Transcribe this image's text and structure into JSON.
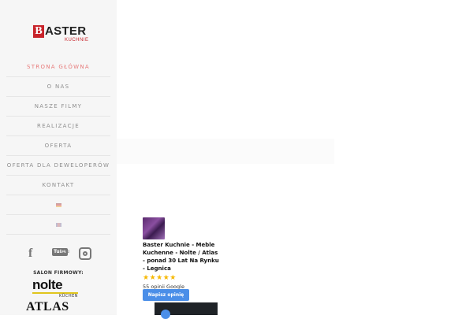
{
  "logo": {
    "letter": "B",
    "text": "ASTER",
    "sub": "KUCHNIE"
  },
  "nav": {
    "items": [
      {
        "label": "Strona główna",
        "active": true
      },
      {
        "label": "O nas",
        "active": false
      },
      {
        "label": "Nasze filmy",
        "active": false
      },
      {
        "label": "Realizacje",
        "active": false
      },
      {
        "label": "Oferta",
        "active": false
      },
      {
        "label": "Oferta dla deweloperów",
        "active": false
      },
      {
        "label": "Kontakt",
        "active": false
      }
    ],
    "flags": [
      "german-flag-icon",
      "uk-flag-icon"
    ]
  },
  "social": {
    "icons": [
      "facebook-icon",
      "youtube-icon",
      "instagram-icon"
    ],
    "youtube_text": "You",
    "youtube_tube": "Tube"
  },
  "salon": {
    "label": "SALON FIRMOWY:",
    "nolte": "nolte",
    "nolte_sub": "KÜCHEN",
    "atlas": "ATLAS"
  },
  "review": {
    "title": "Baster Kuchnie - Meble Kuchenne - Nolte / Atlas - ponad 30 Lat Na Rynku - Legnica",
    "stars": "★★★★★",
    "rating": 5,
    "count": "55 opinii Google",
    "button": "Napisz opinię"
  },
  "colors": {
    "accent": "#c8242b",
    "active_nav": "#e77a7a",
    "button": "#4a8ee8",
    "stars": "#f6b800"
  }
}
